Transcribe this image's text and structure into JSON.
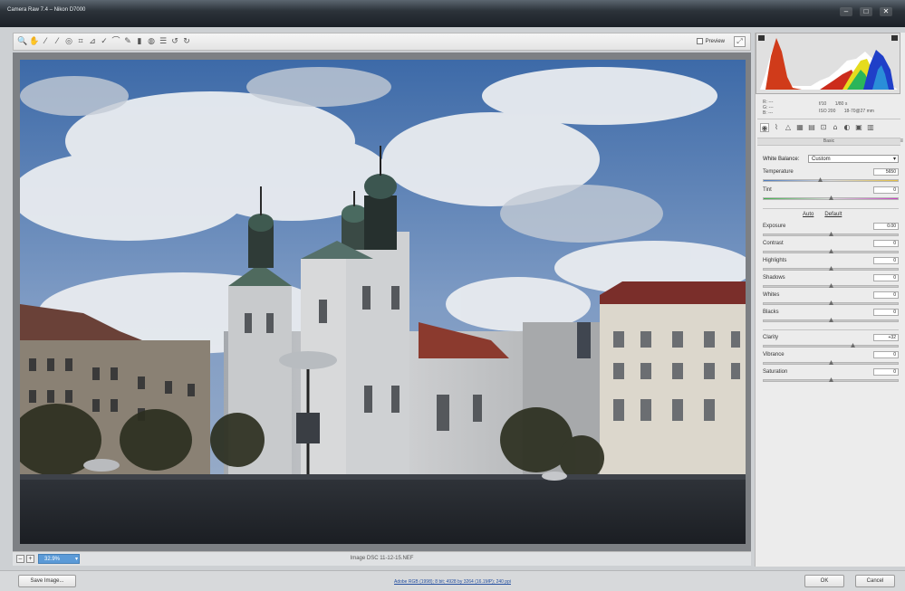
{
  "window": {
    "title": "Camera Raw 7.4  –  Nikon D7000",
    "minimize": "–",
    "maximize": "□",
    "close": "✕"
  },
  "toolbar": {
    "tools": [
      {
        "name": "zoom-tool-icon",
        "glyph": "🔍"
      },
      {
        "name": "hand-tool-icon",
        "glyph": "✋"
      },
      {
        "name": "white-balance-tool-icon",
        "glyph": "⁄"
      },
      {
        "name": "color-sampler-tool-icon",
        "glyph": "⁄"
      },
      {
        "name": "targeted-adjustment-tool-icon",
        "glyph": "◎"
      },
      {
        "name": "crop-tool-icon",
        "glyph": "⌗"
      },
      {
        "name": "straighten-tool-icon",
        "glyph": "⊿"
      },
      {
        "name": "spot-removal-tool-icon",
        "glyph": "✓"
      },
      {
        "name": "red-eye-tool-icon",
        "glyph": "⌒"
      },
      {
        "name": "adjustment-brush-icon",
        "glyph": "✎"
      },
      {
        "name": "graduated-filter-icon",
        "glyph": "▮"
      },
      {
        "name": "radial-filter-icon",
        "glyph": "◍"
      },
      {
        "name": "preferences-icon",
        "glyph": "☰"
      },
      {
        "name": "rotate-ccw-icon",
        "glyph": "↺"
      },
      {
        "name": "rotate-cw-icon",
        "glyph": "↻"
      }
    ],
    "preview_label": "Preview",
    "fullscreen_glyph": "⤢"
  },
  "status": {
    "zoom_out": "–",
    "zoom_in": "+",
    "zoom_value": "32.9%",
    "zoom_arrow": "▾",
    "filename": "Image DSC 11-12-15.NEF"
  },
  "panel": {
    "rgb": {
      "r": "R:  ---",
      "g": "G:  ---",
      "b": "B:  ---"
    },
    "camera_info": {
      "aperture": "f/10",
      "shutter": "1/80 s",
      "iso": "ISO 200",
      "lens": "18-70@27 mm"
    },
    "tabs": [
      {
        "name": "basic-tab-icon",
        "glyph": "◉"
      },
      {
        "name": "tone-curve-tab-icon",
        "glyph": "⌇"
      },
      {
        "name": "detail-tab-icon",
        "glyph": "△"
      },
      {
        "name": "hsl-tab-icon",
        "glyph": "▦"
      },
      {
        "name": "split-toning-tab-icon",
        "glyph": "▤"
      },
      {
        "name": "lens-corrections-tab-icon",
        "glyph": "⊡"
      },
      {
        "name": "effects-tab-icon",
        "glyph": "⌂"
      },
      {
        "name": "camera-calibration-tab-icon",
        "glyph": "◐"
      },
      {
        "name": "presets-tab-icon",
        "glyph": "▣"
      },
      {
        "name": "snapshots-tab-icon",
        "glyph": "▥"
      }
    ],
    "section_title": "Basic",
    "section_menu": "≡",
    "white_balance_label": "White Balance:",
    "white_balance_value": "Custom",
    "dropdown_arrow": "▾",
    "temperature": {
      "label": "Temperature",
      "value": "5650",
      "position": 0.42
    },
    "tint": {
      "label": "Tint",
      "value": "0",
      "position": 0.5
    },
    "auto": "Auto",
    "default": "Default",
    "exposure": {
      "label": "Exposure",
      "value": "0.00",
      "position": 0.5
    },
    "contrast": {
      "label": "Contrast",
      "value": "0",
      "position": 0.5
    },
    "highlights": {
      "label": "Highlights",
      "value": "0",
      "position": 0.5
    },
    "shadows": {
      "label": "Shadows",
      "value": "0",
      "position": 0.5
    },
    "whites": {
      "label": "Whites",
      "value": "0",
      "position": 0.5
    },
    "blacks": {
      "label": "Blacks",
      "value": "0",
      "position": 0.5
    },
    "clarity": {
      "label": "Clarity",
      "value": "+32",
      "position": 0.66
    },
    "vibrance": {
      "label": "Vibrance",
      "value": "0",
      "position": 0.5
    },
    "saturation": {
      "label": "Saturation",
      "value": "0",
      "position": 0.5
    }
  },
  "bottom": {
    "save_label": "Save Image...",
    "workflow_link": "Adobe RGB (1998); 8 bit; 4928 by 3264 (16.1MP); 240 ppi",
    "ok_label": "OK",
    "cancel_label": "Cancel"
  }
}
